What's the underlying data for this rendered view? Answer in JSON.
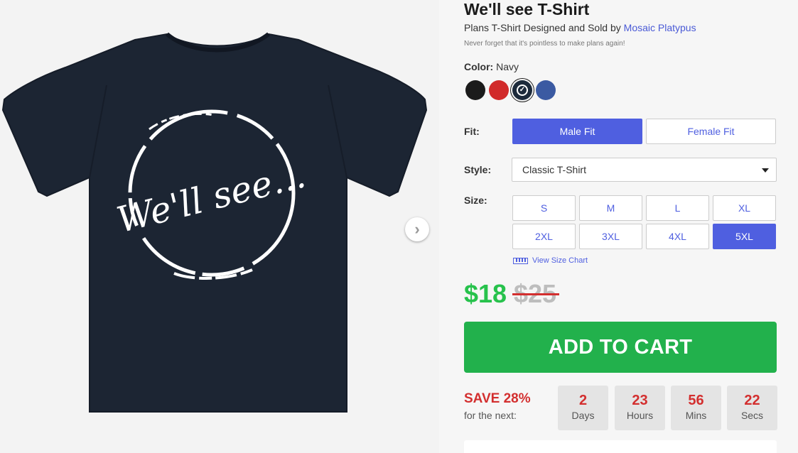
{
  "product": {
    "title": "We'll see T-Shirt",
    "byline_prefix": "Plans T-Shirt Designed and Sold by ",
    "artist": "Mosaic Platypus",
    "tagline": "Never forget that it's pointless to make plans again!",
    "design_text": "We'll see..."
  },
  "color": {
    "label": "Color:",
    "selected": "Navy",
    "swatches": [
      {
        "name": "Black",
        "hex": "#1b1b1b"
      },
      {
        "name": "Red",
        "hex": "#d12a2a"
      },
      {
        "name": "Navy",
        "hex": "#1c2a3b",
        "selected": true
      },
      {
        "name": "Blue",
        "hex": "#3b5aa2"
      }
    ]
  },
  "fit": {
    "label": "Fit:",
    "options": [
      "Male Fit",
      "Female Fit"
    ],
    "selected": "Male Fit"
  },
  "style": {
    "label": "Style:",
    "value": "Classic T-Shirt"
  },
  "size": {
    "label": "Size:",
    "options": [
      "S",
      "M",
      "L",
      "XL",
      "2XL",
      "3XL",
      "4XL",
      "5XL"
    ],
    "selected": "5XL",
    "chart_link": "View Size Chart"
  },
  "price": {
    "current": "$18",
    "original": "$25"
  },
  "cart": {
    "label": "ADD TO CART"
  },
  "sale": {
    "save_label": "SAVE 28%",
    "sub_label": "for the next:",
    "countdown": [
      {
        "value": "2",
        "unit": "Days"
      },
      {
        "value": "23",
        "unit": "Hours"
      },
      {
        "value": "56",
        "unit": "Mins"
      },
      {
        "value": "22",
        "unit": "Secs"
      }
    ]
  },
  "colors": {
    "accent": "#4f5fe0",
    "buy_green": "#22b14c",
    "price_green": "#27c24c",
    "sale_red": "#d32f2f",
    "shirt_navy": "#1c2533"
  },
  "icons": {
    "next": "chevron-right-icon",
    "ruler": "ruler-icon",
    "check": "checkmark-icon"
  }
}
